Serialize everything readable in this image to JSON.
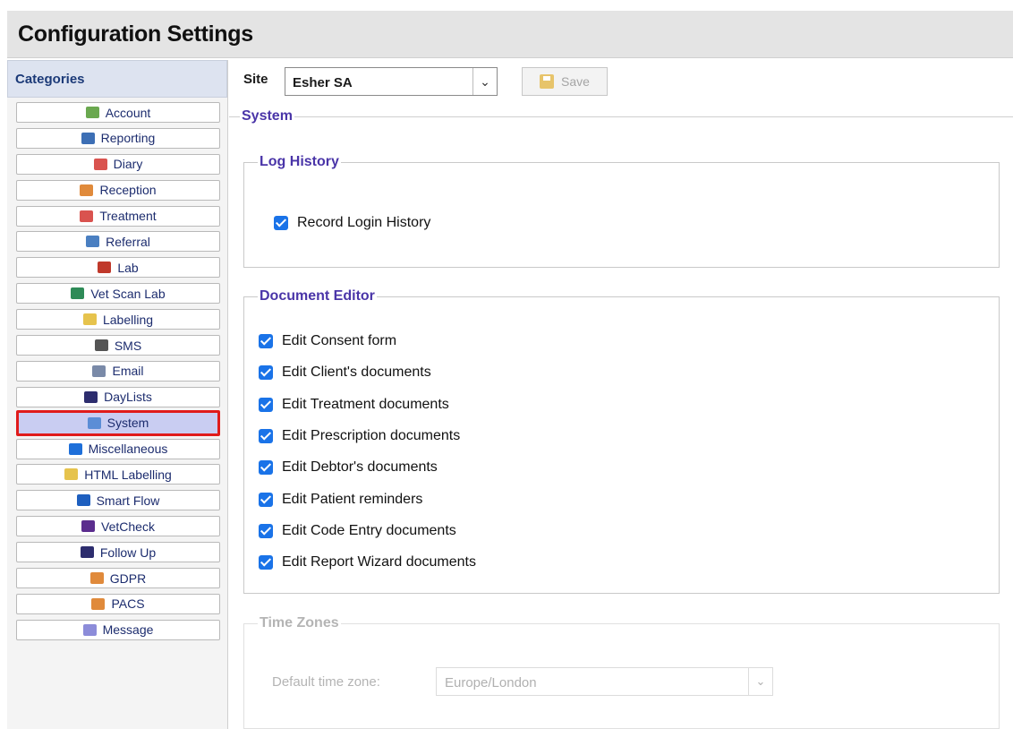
{
  "window": {
    "title": "Configuration Settings"
  },
  "sidebar": {
    "header": "Categories",
    "items": [
      {
        "label": "Account",
        "icon": "account-icon",
        "color": "#6aa84f"
      },
      {
        "label": "Reporting",
        "icon": "reporting-icon",
        "color": "#3d6fb5"
      },
      {
        "label": "Diary",
        "icon": "calendar-icon",
        "color": "#d9534f"
      },
      {
        "label": "Reception",
        "icon": "receptionist-icon",
        "color": "#e08a3b"
      },
      {
        "label": "Treatment",
        "icon": "treatment-icon",
        "color": "#d9534f"
      },
      {
        "label": "Referral",
        "icon": "referral-icon",
        "color": "#4a7fc1"
      },
      {
        "label": "Lab",
        "icon": "lab-icon",
        "color": "#c0392b"
      },
      {
        "label": "Vet Scan Lab",
        "icon": "vetscan-icon",
        "color": "#2e8b57"
      },
      {
        "label": "Labelling",
        "icon": "label-icon",
        "color": "#e6c34d"
      },
      {
        "label": "SMS",
        "icon": "phone-icon",
        "color": "#555555"
      },
      {
        "label": "Email",
        "icon": "email-icon",
        "color": "#7a8aa8"
      },
      {
        "label": "DayLists",
        "icon": "list-icon",
        "color": "#2d2d6e"
      },
      {
        "label": "System",
        "icon": "system-icon",
        "color": "#5b8dd6"
      },
      {
        "label": "Miscellaneous",
        "icon": "info-icon",
        "color": "#1e6fd9"
      },
      {
        "label": "HTML Labelling",
        "icon": "html-label-icon",
        "color": "#e6c34d"
      },
      {
        "label": "Smart Flow",
        "icon": "smartflow-icon",
        "color": "#1e5fbf"
      },
      {
        "label": "VetCheck",
        "icon": "vetcheck-icon",
        "color": "#5b2d8e"
      },
      {
        "label": "Follow Up",
        "icon": "followup-icon",
        "color": "#2d2d6e"
      },
      {
        "label": "GDPR",
        "icon": "gdpr-icon",
        "color": "#e08a3b"
      },
      {
        "label": "PACS",
        "icon": "pacs-icon",
        "color": "#e08a3b"
      },
      {
        "label": "Message",
        "icon": "message-icon",
        "color": "#8c8cd9"
      }
    ],
    "selected": "System"
  },
  "toolbar": {
    "site_label": "Site",
    "site_value": "Esher SA",
    "save_label": "Save"
  },
  "main": {
    "section_title": "System",
    "log_history": {
      "title": "Log History",
      "items": [
        {
          "label": "Record Login History",
          "checked": true
        }
      ]
    },
    "document_editor": {
      "title": "Document Editor",
      "items": [
        {
          "label": "Edit Consent form",
          "checked": true
        },
        {
          "label": "Edit Client's documents",
          "checked": true
        },
        {
          "label": "Edit Treatment documents",
          "checked": true
        },
        {
          "label": "Edit Prescription documents",
          "checked": true
        },
        {
          "label": "Edit Debtor's documents",
          "checked": true
        },
        {
          "label": "Edit Patient reminders",
          "checked": true
        },
        {
          "label": "Edit Code Entry documents",
          "checked": true
        },
        {
          "label": "Edit Report Wizard documents",
          "checked": true
        }
      ]
    },
    "time_zones": {
      "title": "Time Zones",
      "field_label": "Default time zone:",
      "value": "Europe/London"
    }
  },
  "colors": {
    "accent": "#1a73e8",
    "legend": "#4a35a8",
    "selection_border": "#e01b1b",
    "selection_bg": "#c9cdf2"
  }
}
